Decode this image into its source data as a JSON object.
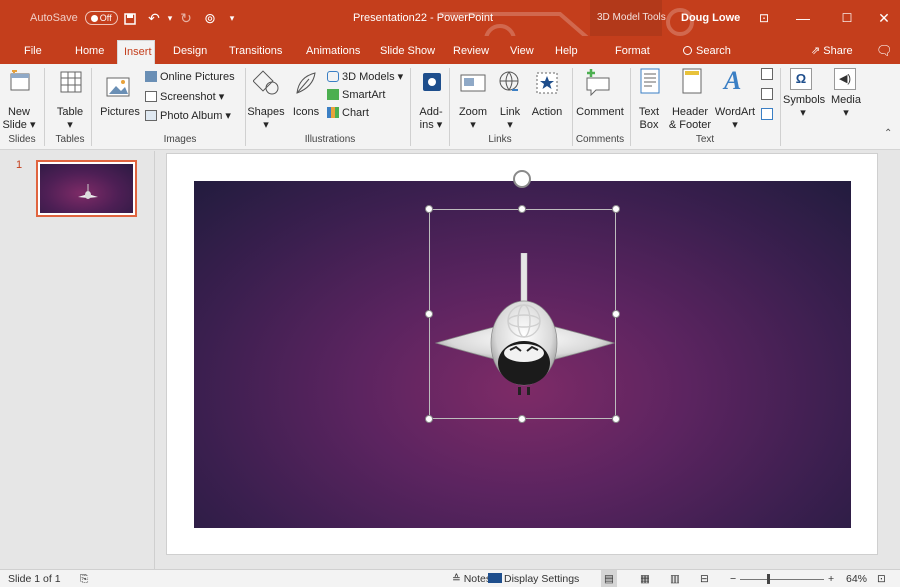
{
  "titlebar": {
    "autosave_label": "AutoSave",
    "autosave_state": "Off",
    "doc_title": "Presentation22 - PowerPoint",
    "context_tools": "3D Model Tools",
    "user_name": "Doug Lowe",
    "icons": [
      "save-icon",
      "undo-icon",
      "redo-icon",
      "present-from-start-icon",
      "customize-qat-icon",
      "ribbon-display-options-icon",
      "minimize-icon",
      "maximize-icon",
      "close-icon"
    ]
  },
  "tabs": {
    "file": "File",
    "home": "Home",
    "insert": "Insert",
    "design": "Design",
    "transitions": "Transitions",
    "animations": "Animations",
    "slideshow": "Slide Show",
    "review": "Review",
    "view": "View",
    "help": "Help",
    "format": "Format",
    "search": "Search",
    "share": "Share"
  },
  "ribbon": {
    "new_slide": [
      "New",
      "Slide ▾"
    ],
    "table": [
      "Table",
      "▾"
    ],
    "pictures": "Pictures",
    "online_pictures": "Online Pictures",
    "screenshot": "Screenshot ▾",
    "photo_album": "Photo Album ▾",
    "shapes": [
      "Shapes",
      "▾"
    ],
    "icons": "Icons",
    "models_3d": "3D Models ▾",
    "smartart": "SmartArt",
    "chart": "Chart",
    "addins": [
      "Add-",
      "ins ▾"
    ],
    "zoom": [
      "Zoom",
      "▾"
    ],
    "link": [
      "Link",
      "▾"
    ],
    "action": "Action",
    "comment": "Comment",
    "textbox": [
      "Text",
      "Box"
    ],
    "header_footer": [
      "Header",
      "& Footer"
    ],
    "wordart": [
      "WordArt",
      "▾"
    ],
    "symbols": [
      "Symbols",
      "▾"
    ],
    "media": [
      "Media",
      "▾"
    ],
    "groups": {
      "slides": "Slides",
      "tables": "Tables",
      "images": "Images",
      "illustrations": "Illustrations",
      "links": "Links",
      "comments": "Comments",
      "text": "Text"
    }
  },
  "thumbnails": {
    "slide_number": "1"
  },
  "statusbar": {
    "slide_info": "Slide 1 of 1",
    "notes": "Notes",
    "display_settings": "Display Settings",
    "zoom_level": "64%",
    "zoom_fraction": 0.64,
    "zoom_minus": "−",
    "zoom_plus": "+"
  },
  "colors": {
    "brand": "#c43e1c",
    "ribbon_bg": "#f3f3f3",
    "slide_center": "#7e2b67",
    "slide_edge": "#221c3e"
  }
}
